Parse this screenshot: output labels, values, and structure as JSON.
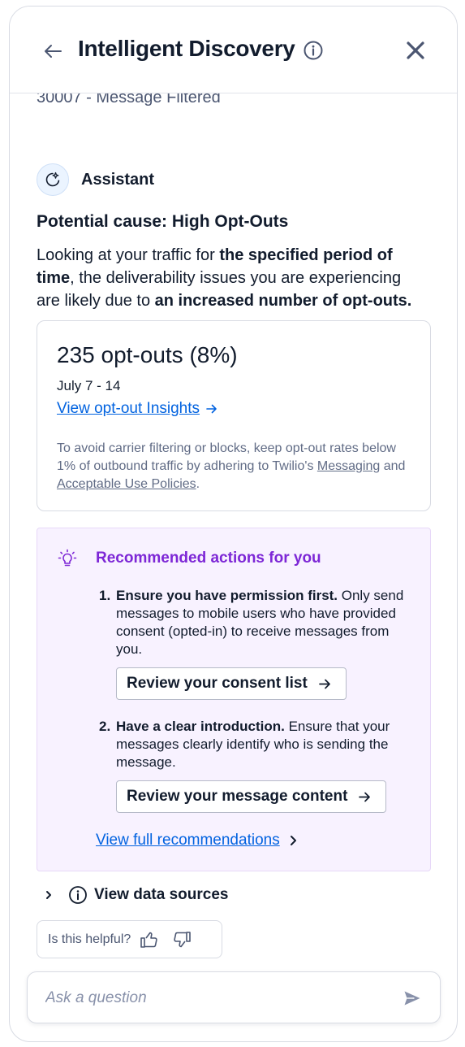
{
  "header": {
    "title": "Intelligent Discovery",
    "back_icon": "arrow-left-icon",
    "info_icon": "info-icon",
    "close_icon": "close-icon"
  },
  "error_code_line": "30007 - Message Filtered",
  "assistant": {
    "label": "Assistant",
    "icon": "sparkle-assistant-icon"
  },
  "cause": {
    "title": "Potential cause: High Opt-Outs",
    "body_1": "Looking at your traffic for ",
    "body_bold_1": "the specified period of time",
    "body_2": ", the deliverability issues you are experiencing are likely due to ",
    "body_bold_2": "an increased number of opt-outs."
  },
  "stat": {
    "value": "235 opt-outs (8%)",
    "range": "July 7 - 14",
    "link_label": "View opt-out Insights",
    "note_1": "To avoid carrier filtering or blocks, keep opt-out rates below 1% of outbound traffic by adhering to Twilio's ",
    "note_link_1": "Messaging",
    "note_and": " and ",
    "note_link_2": "Acceptable Use Policies",
    "note_end": "."
  },
  "recommendations": {
    "title": "Recommended actions for you",
    "icon": "lightbulb-icon",
    "items": [
      {
        "num": "1.",
        "bold": "Ensure you have permission first.",
        "text": " Only send messages to mobile users who have provided consent (opted-in) to receive messages from you.",
        "button": "Review your consent list"
      },
      {
        "num": "2.",
        "bold": "Have a clear introduction.",
        "text": " Ensure that your messages clearly identify who is sending the message.",
        "button": "Review your message content"
      }
    ],
    "link_label": "View full recommendations"
  },
  "data_sources": {
    "label": "View data sources"
  },
  "feedback": {
    "label": "Is this helpful?"
  },
  "ask": {
    "placeholder": "Ask a question",
    "value": ""
  },
  "colors": {
    "accent_blue": "#0263e0",
    "purple": "#7d27d6",
    "rec_bg": "#f8f2ff",
    "text": "#121c2d"
  }
}
